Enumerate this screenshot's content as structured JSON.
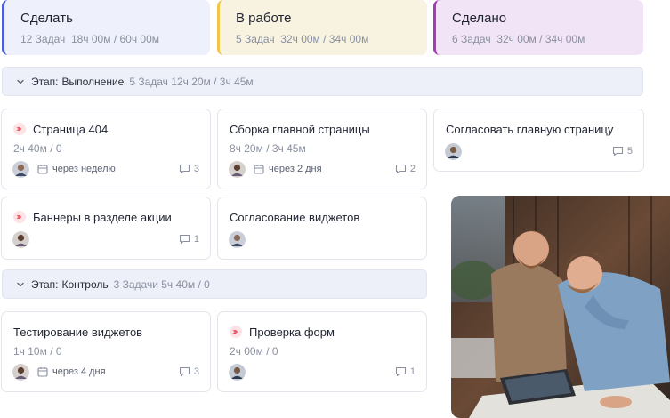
{
  "columns": [
    {
      "title": "Сделать",
      "tasks": "12 Задач",
      "hours": "18ч 00м / 60ч 00м",
      "color": "#4b5fd6"
    },
    {
      "title": "В работе",
      "tasks": "5 Задач",
      "hours": "32ч 00м / 34ч 00м",
      "color": "#f0c64a"
    },
    {
      "title": "Сделано",
      "tasks": "6 Задач",
      "hours": "32ч 00м / 34ч 00м",
      "color": "#a43cb5"
    }
  ],
  "stages": [
    {
      "label": "Этап:",
      "name": "Выполнение",
      "meta": "5 Задач 12ч 20м / 3ч 45м"
    },
    {
      "label": "Этап:",
      "name": "Контроль",
      "meta": "3 Задачи 5ч 40м / 0"
    }
  ],
  "cards": {
    "c1": {
      "title": "Страница 404",
      "time": "2ч 40м / 0",
      "due": "через неделю",
      "comments": "3",
      "priority": true
    },
    "c2": {
      "title": "Сборка главной страницы",
      "time": "8ч 20м / 3ч 45м",
      "due": "через 2 дня",
      "comments": "2",
      "priority": false
    },
    "c3": {
      "title": "Согласовать главную страницу",
      "comments": "5",
      "priority": false
    },
    "c4": {
      "title": "Баннеры в разделе акции",
      "comments": "1",
      "priority": true
    },
    "c5": {
      "title": "Согласование виджетов",
      "priority": false
    },
    "c6": {
      "title": "Тестирование виджетов",
      "time": "1ч 10м / 0",
      "due": "через 4 дня",
      "comments": "3",
      "priority": false
    },
    "c7": {
      "title": "Проверка форм",
      "time": "2ч 00м / 0",
      "comments": "1",
      "priority": true
    }
  },
  "icons": {
    "priority": "priority-flag-icon",
    "calendar": "calendar-icon",
    "comment": "comment-icon",
    "chevron": "chevron-down-icon"
  },
  "colors": {
    "priority": "#ef5b66",
    "stage_bg": "#edf0f8",
    "muted": "#8a90a0"
  }
}
